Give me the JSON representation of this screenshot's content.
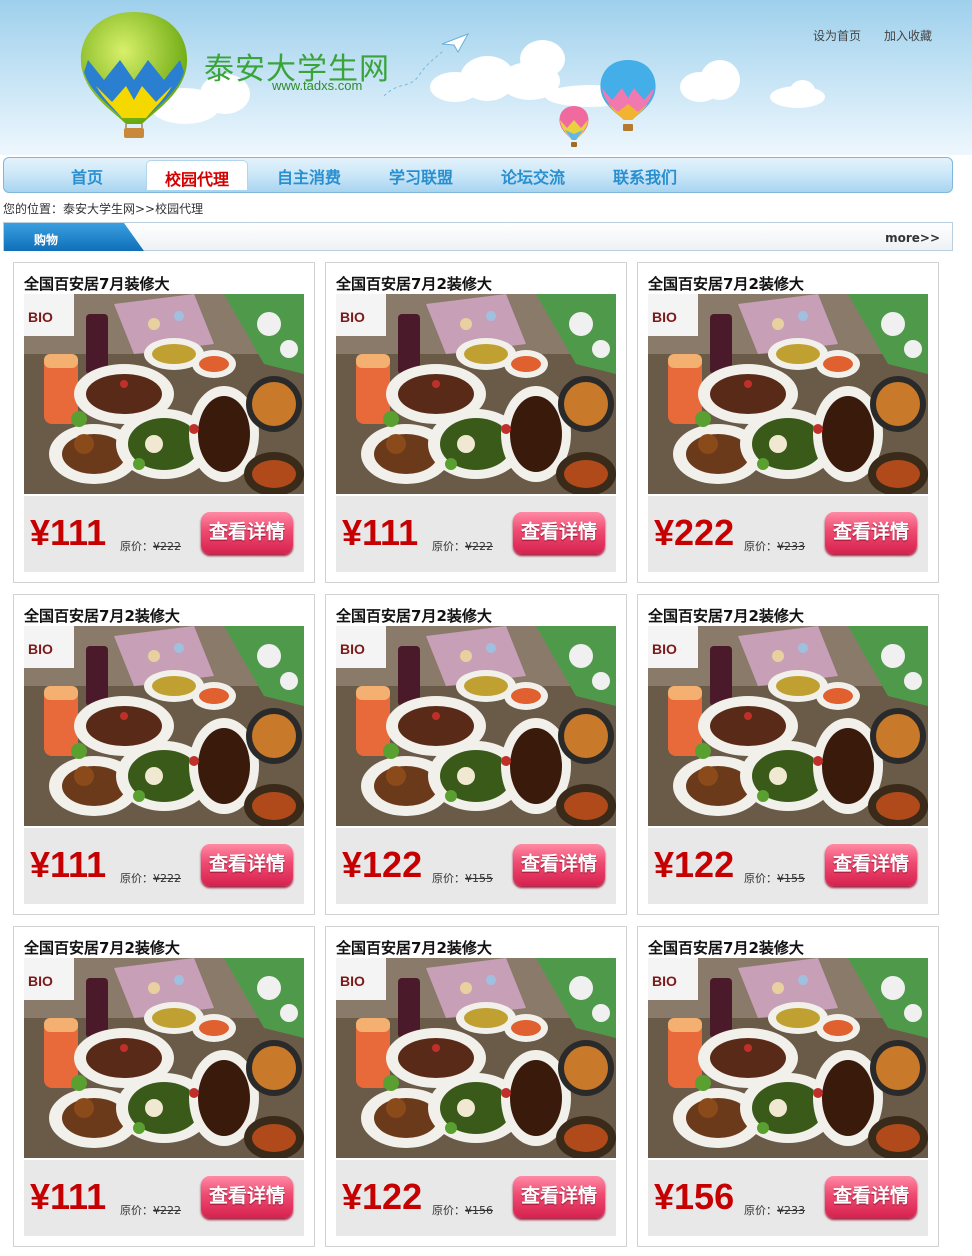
{
  "site": {
    "name": "泰安大学生网",
    "url": "www.tadxs.com",
    "top_links": [
      "设为首页",
      "加入收藏"
    ]
  },
  "nav": {
    "items": [
      "首页",
      "校园代理",
      "自主消费",
      "学习联盟",
      "论坛交流",
      "联系我们"
    ],
    "active": "校园代理"
  },
  "breadcrumb": "您的位置：泰安大学生网>>校园代理",
  "section": {
    "tab": "购物",
    "more": "more>>"
  },
  "products": [
    {
      "title": "全国百安居7月装修大",
      "price": "¥111",
      "orig_label": "原价：",
      "orig_price": "¥222",
      "button": "查看详情"
    },
    {
      "title": "全国百安居7月2装修大",
      "price": "¥111",
      "orig_label": "原价：",
      "orig_price": "¥222",
      "button": "查看详情"
    },
    {
      "title": "全国百安居7月2装修大",
      "price": "¥222",
      "orig_label": "原价：",
      "orig_price": "¥233",
      "button": "查看详情"
    },
    {
      "title": "全国百安居7月2装修大",
      "price": "¥111",
      "orig_label": "原价：",
      "orig_price": "¥222",
      "button": "查看详情"
    },
    {
      "title": "全国百安居7月2装修大",
      "price": "¥122",
      "orig_label": "原价：",
      "orig_price": "¥155",
      "button": "查看详情"
    },
    {
      "title": "全国百安居7月2装修大",
      "price": "¥122",
      "orig_label": "原价：",
      "orig_price": "¥155",
      "button": "查看详情"
    },
    {
      "title": "全国百安居7月2装修大",
      "price": "¥111",
      "orig_label": "原价：",
      "orig_price": "¥222",
      "button": "查看详情"
    },
    {
      "title": "全国百安居7月2装修大",
      "price": "¥122",
      "orig_label": "原价：",
      "orig_price": "¥156",
      "button": "查看详情"
    },
    {
      "title": "全国百安居7月2装修大",
      "price": "¥156",
      "orig_label": "原价：",
      "orig_price": "¥233",
      "button": "查看详情"
    }
  ],
  "colors": {
    "price": "#c60000",
    "nav_text": "#2a8fcf",
    "nav_active": "#d40000",
    "button": "#e0305a"
  },
  "icons": [
    "hot-air-balloon-icon",
    "paper-plane-icon"
  ]
}
